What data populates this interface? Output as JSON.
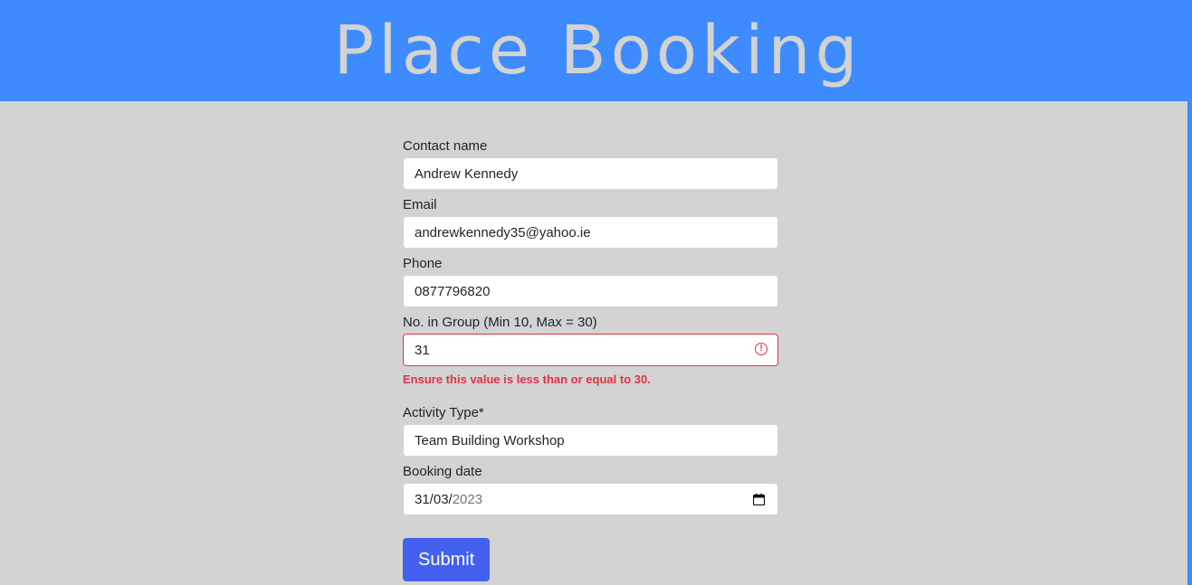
{
  "header": {
    "title": "Place Booking"
  },
  "form": {
    "contact_name": {
      "label": "Contact name",
      "value": "Andrew Kennedy"
    },
    "email": {
      "label": "Email",
      "value": "andrewkennedy35@yahoo.ie"
    },
    "phone": {
      "label": "Phone",
      "value": "0877796820"
    },
    "group_size": {
      "label": "No. in Group (Min 10, Max = 30)",
      "value": "31",
      "error": "Ensure this value is less than or equal to 30."
    },
    "activity_type": {
      "label": "Activity Type*",
      "value": "Team Building Workshop"
    },
    "booking_date": {
      "label": "Booking date",
      "value_day_month": "31/03/",
      "value_year": "2023"
    },
    "submit_label": "Submit"
  },
  "colors": {
    "header_bg": "#3d8bfd",
    "page_bg": "#d3d3d3",
    "error": "#dc3545",
    "submit_bg": "#4361ee"
  }
}
